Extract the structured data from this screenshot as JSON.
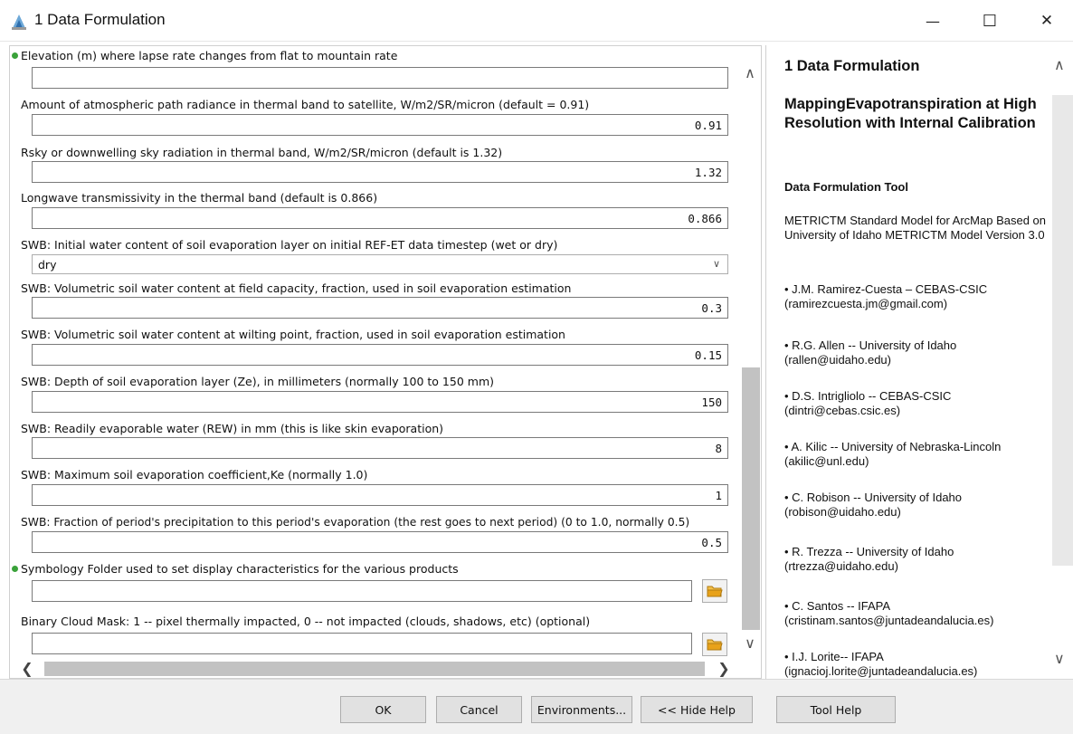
{
  "window": {
    "title": "1 Data Formulation",
    "minimize_glyph": "—",
    "maximize_glyph": "☐",
    "close_glyph": "✕"
  },
  "form": {
    "fields": [
      {
        "label": "Elevation (m) where lapse rate changes from flat to mountain rate",
        "value": "",
        "required": true
      },
      {
        "label": "Amount of atmospheric path radiance in thermal band to satellite, W/m2/SR/micron (default = 0.91)",
        "value": "0.91"
      },
      {
        "label": "Rsky or downwelling sky radiation in thermal band, W/m2/SR/micron (default is 1.32)",
        "value": "1.32"
      },
      {
        "label": "Longwave transmissivity in the thermal band (default is 0.866)",
        "value": "0.866"
      },
      {
        "label": "SWB: Initial water content of soil evaporation layer on initial REF-ET data timestep (wet or dry)",
        "value": "dry"
      },
      {
        "label": "SWB: Volumetric soil water content at field capacity, fraction, used in soil evaporation estimation",
        "value": "0.3"
      },
      {
        "label": "SWB: Volumetric soil water content at wilting point, fraction, used in soil evaporation estimation",
        "value": "0.15"
      },
      {
        "label": "SWB: Depth of soil evaporation layer (Ze), in millimeters (normally 100 to 150 mm)",
        "value": "150"
      },
      {
        "label": "SWB: Readily evaporable water (REW) in mm (this is like skin evaporation)",
        "value": "8"
      },
      {
        "label": "SWB: Maximum soil evaporation coefficient,Ke (normally 1.0)",
        "value": "1"
      },
      {
        "label": "SWB: Fraction of period's precipitation to this period's evaporation (the rest goes to next period) (0 to 1.0, normally 0.5)",
        "value": "0.5"
      },
      {
        "label": "Symbology Folder used to set display characteristics for the various products",
        "value": "",
        "required": true
      },
      {
        "label": "Binary Cloud Mask: 1 -- pixel thermally impacted, 0 -- not impacted (clouds, shadows, etc) (optional)",
        "value": ""
      }
    ]
  },
  "help": {
    "title": "1 Data Formulation",
    "subtitle": "MappingEvapotranspiration at High Resolution with Internal Calibration",
    "tool_heading": "Data Formulation Tool",
    "description": "METRICTM Standard Model for ArcMap Based on University of Idaho METRICTM Model Version 3.0",
    "people": [
      {
        "line1": "• J.M. Ramirez-Cuesta – CEBAS-CSIC",
        "line2": "(ramirezcuesta.jm@gmail.com)"
      },
      {
        "line1": "• R.G. Allen -- University of Idaho",
        "line2": "(rallen@uidaho.edu)"
      },
      {
        "line1": "• D.S. Intrigliolo -- CEBAS-CSIC",
        "line2": "(dintri@cebas.csic.es)"
      },
      {
        "line1": "• A. Kilic -- University of Nebraska-Lincoln",
        "line2": "(akilic@unl.edu)"
      },
      {
        "line1": "• C. Robison -- University of Idaho",
        "line2": "(robison@uidaho.edu)"
      },
      {
        "line1": "• R. Trezza -- University of Idaho",
        "line2": "(rtrezza@uidaho.edu)"
      },
      {
        "line1": "• C. Santos -- IFAPA",
        "line2": "(cristinam.santos@juntadeandalucia.es)"
      },
      {
        "line1": "• I.J. Lorite-- IFAPA",
        "line2": "(ignacioj.lorite@juntadeandalucia.es)"
      }
    ]
  },
  "buttons": {
    "ok": "OK",
    "cancel": "Cancel",
    "environments": "Environments...",
    "hide_help": "<< Hide Help",
    "tool_help": "Tool Help"
  },
  "colors": {
    "required_dot": "#3aa23a",
    "folder_icon": "#e8a21a"
  }
}
